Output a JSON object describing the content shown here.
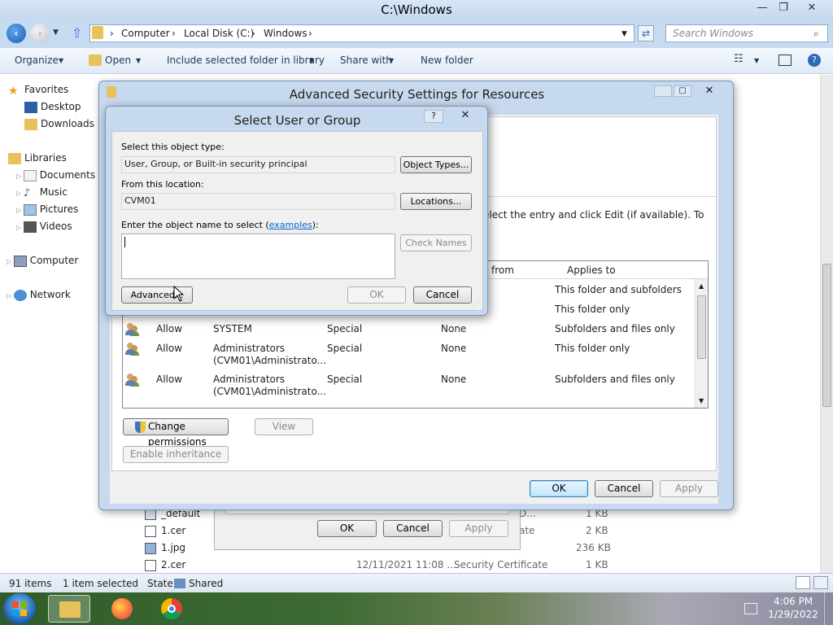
{
  "window": {
    "title": "C:\\Windows",
    "controls": {
      "minimize": "—",
      "maximize": "❐",
      "close": "✕"
    }
  },
  "address": {
    "path": [
      "Computer",
      "Local Disk (C:)",
      "Windows"
    ],
    "search_placeholder": "Search Windows"
  },
  "toolbar": {
    "organize": "Organize",
    "open": "Open",
    "include": "Include selected folder in library",
    "share": "Share with",
    "new_folder": "New folder"
  },
  "nav": {
    "favorites": "Favorites",
    "desktop": "Desktop",
    "downloads": "Downloads",
    "libraries": "Libraries",
    "documents": "Documents",
    "music": "Music",
    "pictures": "Pictures",
    "videos": "Videos",
    "computer": "Computer",
    "network": "Network"
  },
  "files": [
    {
      "name": "_default",
      "date": "",
      "type": "D...",
      "size": "1 KB"
    },
    {
      "name": "1.cer",
      "date": "",
      "type": "ate",
      "size": "2 KB"
    },
    {
      "name": "1.jpg",
      "date": "",
      "type": "",
      "size": "236 KB"
    },
    {
      "name": "2.cer",
      "date": "12/11/2021 11:08 ...",
      "type": "Security Certificate",
      "size": "1 KB"
    }
  ],
  "status": {
    "items": "91 items",
    "selected": "1 item selected",
    "state_label": "State:",
    "state_value": "Shared"
  },
  "props_dialog": {
    "ok": "OK",
    "cancel": "Cancel",
    "apply": "Apply"
  },
  "adv_dialog": {
    "title": "Advanced Security Settings for Resources",
    "instructions": "elect the entry and click Edit (if available). To",
    "headers": {
      "inherited": "from",
      "applies": "Applies to"
    },
    "rows": [
      {
        "type": "",
        "principal": "",
        "principal2": "",
        "access": "",
        "inherited": "",
        "applies": "This folder and subfolders"
      },
      {
        "type": "",
        "principal": "",
        "principal2": "",
        "access": "",
        "inherited": "",
        "applies": "This folder only"
      },
      {
        "type": "Allow",
        "principal": "SYSTEM",
        "principal2": "",
        "access": "Special",
        "inherited": "None",
        "applies": "Subfolders and files only"
      },
      {
        "type": "Allow",
        "principal": "Administrators",
        "principal2": "(CVM01\\Administrato...",
        "access": "Special",
        "inherited": "None",
        "applies": "This folder only"
      },
      {
        "type": "Allow",
        "principal": "Administrators",
        "principal2": "(CVM01\\Administrato...",
        "access": "Special",
        "inherited": "None",
        "applies": "Subfolders and files only"
      }
    ],
    "change_permissions": "Change permissions",
    "view": "View",
    "enable_inheritance": "Enable inheritance",
    "ok": "OK",
    "cancel": "Cancel",
    "apply": "Apply"
  },
  "select_dialog": {
    "title": "Select User or Group",
    "help": "?",
    "object_type_label": "Select this object type:",
    "object_type_value": "User, Group, or Built-in security principal",
    "object_types_button": "Object Types...",
    "location_label": "From this location:",
    "location_value": "CVM01",
    "locations_button": "Locations...",
    "name_label_prefix": "Enter the object name to select (",
    "name_label_link": "examples",
    "name_label_suffix": "):",
    "check_names": "Check Names",
    "advanced": "Advanced...",
    "ok": "OK",
    "cancel": "Cancel"
  },
  "taskbar": {
    "time": "4:06 PM",
    "date": "1/29/2022"
  }
}
